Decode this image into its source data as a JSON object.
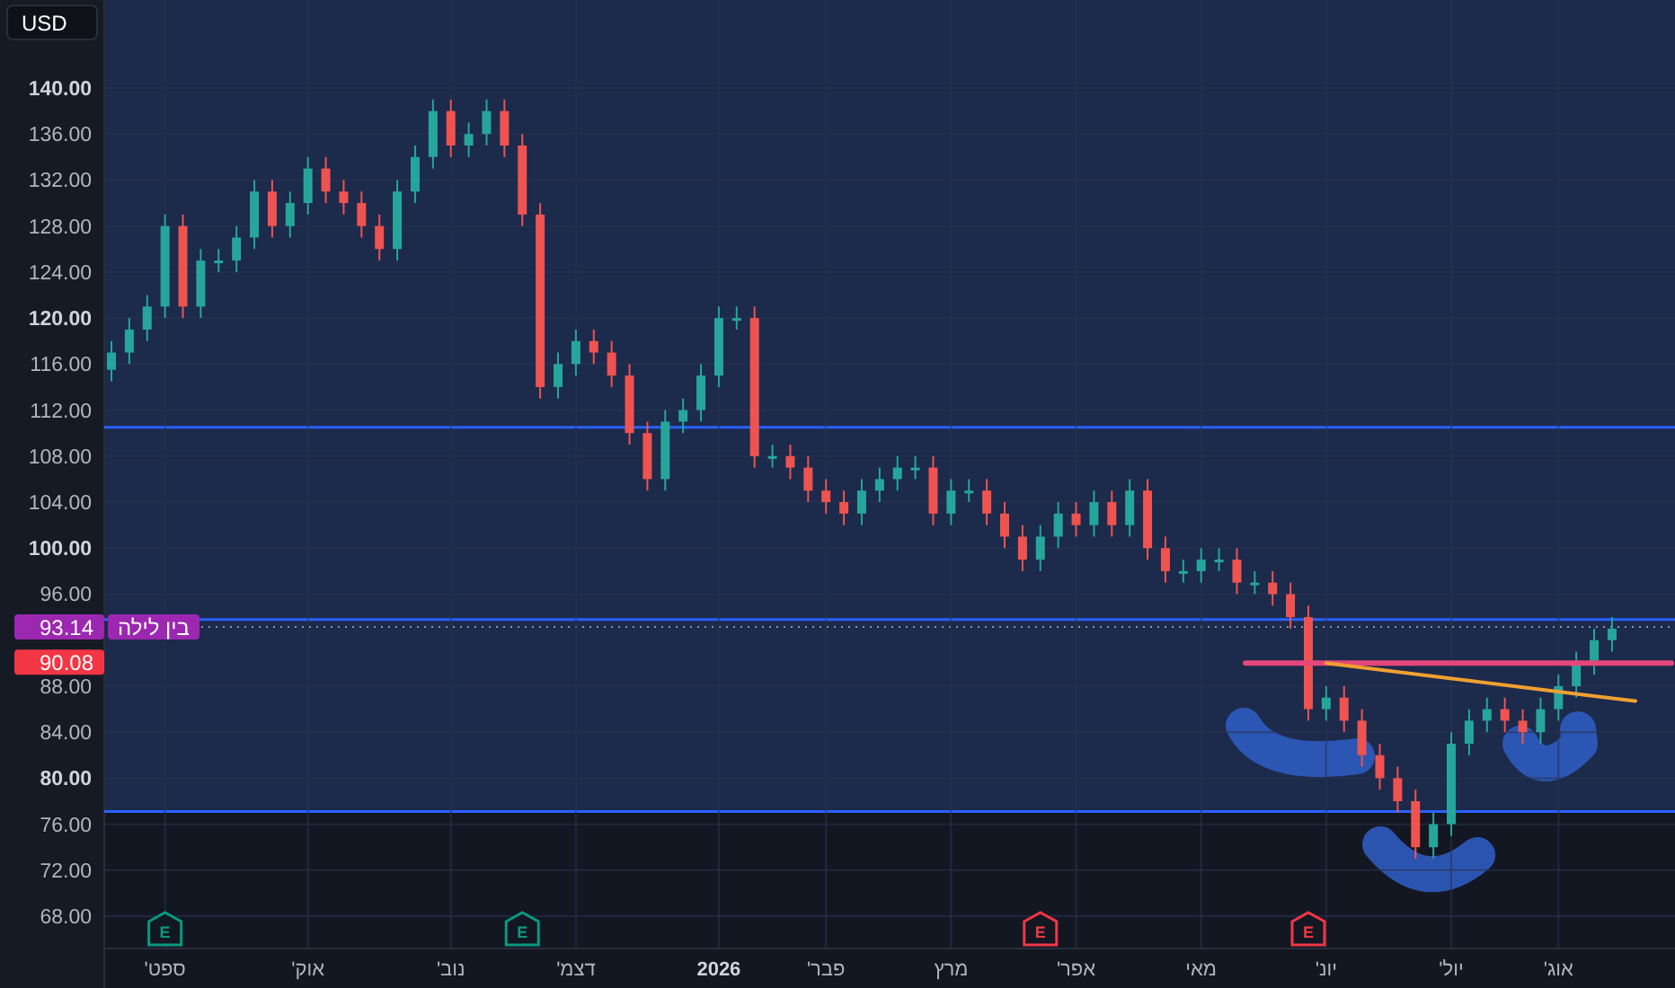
{
  "currency_button": {
    "label": "USD"
  },
  "chart_data": {
    "type": "candlestick",
    "ylim": [
      61.76,
      147.65
    ],
    "yticks": [
      {
        "value": 68,
        "label": "68.00"
      },
      {
        "value": 72,
        "label": "72.00"
      },
      {
        "value": 76,
        "label": "76.00"
      },
      {
        "value": 80,
        "label": "80.00"
      },
      {
        "value": 84,
        "label": "84.00"
      },
      {
        "value": 88,
        "label": "88.00"
      },
      {
        "value": 96,
        "label": "96.00"
      },
      {
        "value": 100,
        "label": "100.00"
      },
      {
        "value": 104,
        "label": "104.00"
      },
      {
        "value": 108,
        "label": "108.00"
      },
      {
        "value": 112,
        "label": "112.00"
      },
      {
        "value": 116,
        "label": "116.00"
      },
      {
        "value": 120,
        "label": "120.00"
      },
      {
        "value": 124,
        "label": "124.00"
      },
      {
        "value": 128,
        "label": "128.00"
      },
      {
        "value": 132,
        "label": "132.00"
      },
      {
        "value": 136,
        "label": "136.00"
      },
      {
        "value": 140,
        "label": "140.00"
      }
    ],
    "categories": [
      null,
      null,
      null,
      "ספט'",
      null,
      null,
      null,
      null,
      null,
      null,
      null,
      "אוק'",
      null,
      null,
      null,
      null,
      null,
      null,
      null,
      "נוב'",
      null,
      null,
      null,
      null,
      null,
      null,
      "דצמ'",
      null,
      null,
      null,
      null,
      null,
      null,
      null,
      "2026",
      null,
      null,
      null,
      null,
      null,
      "פבר'",
      null,
      null,
      null,
      null,
      null,
      null,
      "מרץ",
      null,
      null,
      null,
      null,
      null,
      null,
      "אפר'",
      null,
      null,
      null,
      null,
      null,
      null,
      "מאי",
      null,
      null,
      null,
      null,
      null,
      null,
      "יונ'",
      null,
      null,
      null,
      null,
      null,
      null,
      "יול'",
      null,
      null,
      null,
      null,
      null,
      "אוג'",
      null,
      null,
      null
    ],
    "ohlc": [
      [
        115.5,
        118,
        114.5,
        117
      ],
      [
        117,
        120,
        116,
        119
      ],
      [
        119,
        122,
        118,
        121
      ],
      [
        121,
        129,
        120,
        128
      ],
      [
        128,
        129,
        120,
        121
      ],
      [
        121,
        126,
        120,
        125
      ],
      [
        125,
        126,
        124,
        125
      ],
      [
        125,
        128,
        124,
        127
      ],
      [
        127,
        132,
        126,
        131
      ],
      [
        131,
        132,
        127,
        128
      ],
      [
        128,
        131,
        127,
        130
      ],
      [
        130,
        134,
        129,
        133
      ],
      [
        133,
        134,
        130,
        131
      ],
      [
        131,
        132,
        129,
        130
      ],
      [
        130,
        131,
        127,
        128
      ],
      [
        128,
        129,
        125,
        126
      ],
      [
        126,
        132,
        125,
        131
      ],
      [
        131,
        135,
        130,
        134
      ],
      [
        134,
        139,
        133,
        138
      ],
      [
        138,
        139,
        134,
        135
      ],
      [
        135,
        137,
        134,
        136
      ],
      [
        136,
        139,
        135,
        138
      ],
      [
        138,
        139,
        134,
        135
      ],
      [
        135,
        136,
        128,
        129
      ],
      [
        129,
        130,
        113,
        114
      ],
      [
        114,
        117,
        113,
        116
      ],
      [
        116,
        119,
        115,
        118
      ],
      [
        118,
        119,
        116,
        117
      ],
      [
        117,
        118,
        114,
        115
      ],
      [
        115,
        116,
        109,
        110
      ],
      [
        110,
        111,
        105,
        106
      ],
      [
        106,
        112,
        105,
        111
      ],
      [
        111,
        113,
        110,
        112
      ],
      [
        112,
        116,
        111,
        115
      ],
      [
        115,
        121,
        114,
        120
      ],
      [
        120,
        121,
        119,
        120
      ],
      [
        120,
        121,
        107,
        108
      ],
      [
        108,
        109,
        107,
        108
      ],
      [
        108,
        109,
        106,
        107
      ],
      [
        107,
        108,
        104,
        105
      ],
      [
        105,
        106,
        103,
        104
      ],
      [
        104,
        105,
        102,
        103
      ],
      [
        103,
        106,
        102,
        105
      ],
      [
        105,
        107,
        104,
        106
      ],
      [
        106,
        108,
        105,
        107
      ],
      [
        107,
        108,
        106,
        107
      ],
      [
        107,
        108,
        102,
        103
      ],
      [
        103,
        106,
        102,
        105
      ],
      [
        105,
        106,
        104,
        105
      ],
      [
        105,
        106,
        102,
        103
      ],
      [
        103,
        104,
        100,
        101
      ],
      [
        101,
        102,
        98,
        99
      ],
      [
        99,
        102,
        98,
        101
      ],
      [
        101,
        104,
        100,
        103
      ],
      [
        103,
        104,
        101,
        102
      ],
      [
        102,
        105,
        101,
        104
      ],
      [
        104,
        105,
        101,
        102
      ],
      [
        102,
        106,
        101,
        105
      ],
      [
        105,
        106,
        99,
        100
      ],
      [
        100,
        101,
        97,
        98
      ],
      [
        98,
        99,
        97,
        98
      ],
      [
        98,
        100,
        97,
        99
      ],
      [
        99,
        100,
        98,
        99
      ],
      [
        99,
        100,
        96,
        97
      ],
      [
        97,
        98,
        96,
        97
      ],
      [
        97,
        98,
        95,
        96
      ],
      [
        96,
        97,
        93,
        94
      ],
      [
        94,
        95,
        85,
        86
      ],
      [
        86,
        88,
        85,
        87
      ],
      [
        87,
        88,
        84,
        85
      ],
      [
        85,
        86,
        81,
        82
      ],
      [
        82,
        83,
        79,
        80
      ],
      [
        80,
        81,
        77,
        78
      ],
      [
        78,
        79,
        73,
        74
      ],
      [
        74,
        77,
        73,
        76
      ],
      [
        76,
        84,
        75,
        83
      ],
      [
        83,
        86,
        82,
        85
      ],
      [
        85,
        87,
        84,
        86
      ],
      [
        86,
        87,
        84,
        85
      ],
      [
        85,
        86,
        83,
        84
      ],
      [
        84,
        87,
        83,
        86
      ],
      [
        86,
        89,
        85,
        88
      ],
      [
        88,
        91,
        87,
        90
      ],
      [
        90,
        93,
        89,
        92
      ],
      [
        92,
        94,
        91,
        93
      ]
    ],
    "grid": true
  },
  "earnings": [
    {
      "label": "E",
      "color": "#f23645"
    },
    {
      "label": "E",
      "color": "#f23645"
    },
    {
      "label": "E",
      "color": "#089981"
    },
    {
      "label": "E",
      "color": "#089981"
    }
  ],
  "price_tags": [
    {
      "value": "93.14",
      "color": "#9c27b0",
      "caption": "בין לילה"
    },
    {
      "value": "90.08",
      "color": "#f23645"
    }
  ]
}
